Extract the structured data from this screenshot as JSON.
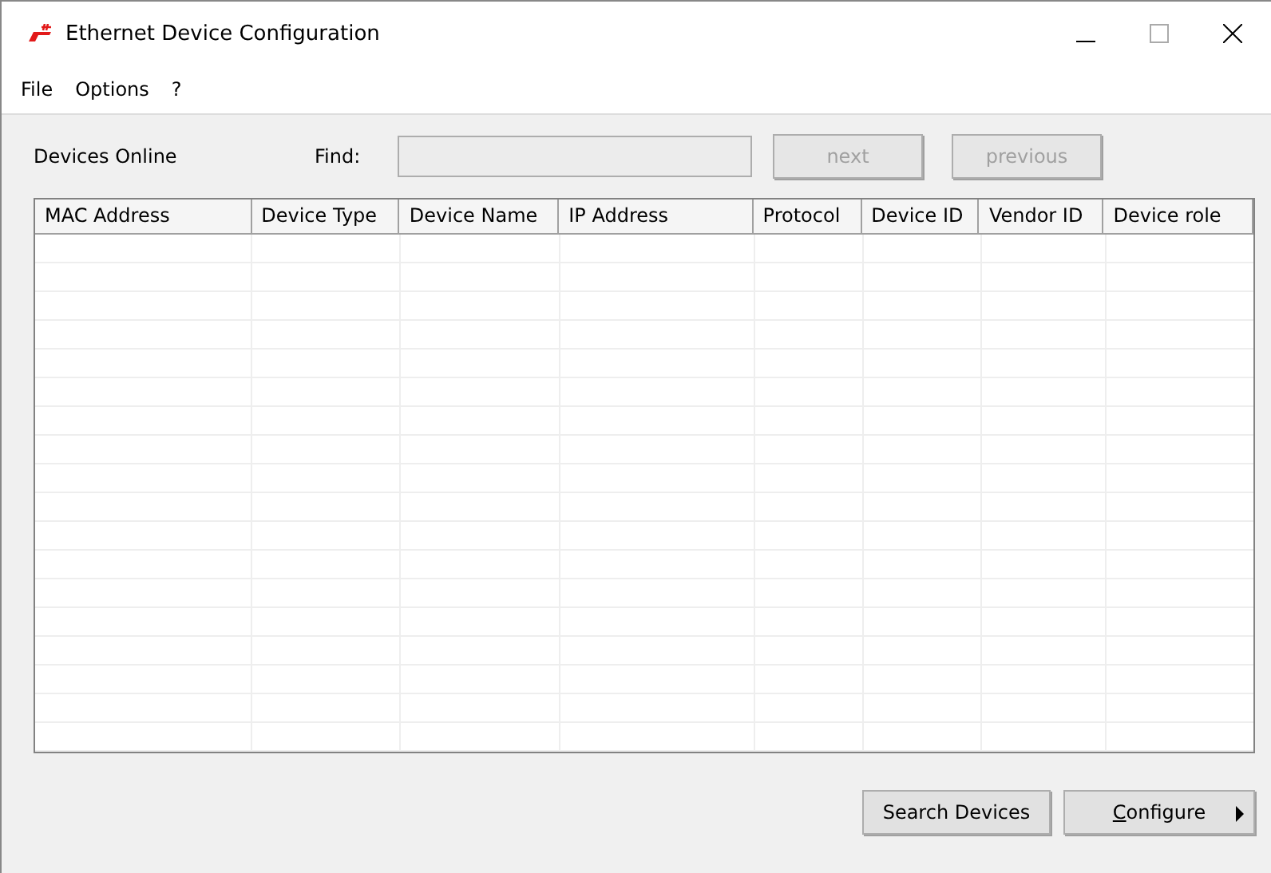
{
  "window": {
    "title": "Ethernet Device Configuration"
  },
  "menu": [
    {
      "label": "File"
    },
    {
      "label": "Options"
    },
    {
      "label": "?"
    }
  ],
  "toolbar": {
    "label": "Devices Online",
    "find_label": "Find:",
    "buttons": [
      {
        "label": "next",
        "disabled": true
      },
      {
        "label": "previous",
        "disabled": true
      }
    ]
  },
  "table": {
    "columns": [
      "MAC Address",
      "Device Type",
      "Device Name",
      "IP Address",
      "Protocol",
      "Device ID",
      "Vendor ID",
      "Device role"
    ]
  },
  "buttons": [
    {
      "label": "Search Devices",
      "kind": "plain"
    },
    {
      "label": "Configure",
      "kind": "menu"
    }
  ]
}
